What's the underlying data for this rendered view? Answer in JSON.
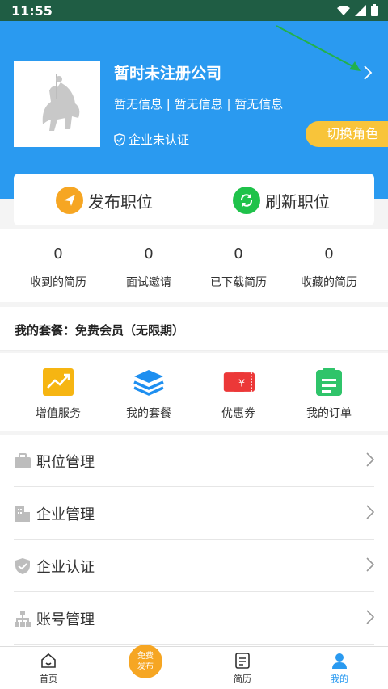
{
  "status_bar": {
    "time": "11:55"
  },
  "header": {
    "company_name": "暂时未注册公司",
    "info_1": "暂无信息",
    "info_2": "暂无信息",
    "info_3": "暂无信息",
    "separator": "|",
    "certification": "企业未认证",
    "switch_role": "切换角色",
    "bg_color": "#2a9af0"
  },
  "actions": {
    "publish": "发布职位",
    "refresh": "刷新职位"
  },
  "stats": [
    {
      "value": "0",
      "label": "收到的简历"
    },
    {
      "value": "0",
      "label": "面试邀请"
    },
    {
      "value": "0",
      "label": "已下载简历"
    },
    {
      "value": "0",
      "label": "收藏的简历"
    }
  ],
  "package": {
    "text": "我的套餐：免费会员（无限期）"
  },
  "services": [
    {
      "label": "增值服务",
      "icon": "trend-icon"
    },
    {
      "label": "我的套餐",
      "icon": "layers-icon"
    },
    {
      "label": "优惠券",
      "icon": "coupon-icon"
    },
    {
      "label": "我的订单",
      "icon": "order-icon"
    }
  ],
  "menu": [
    {
      "label": "职位管理",
      "icon": "briefcase-icon"
    },
    {
      "label": "企业管理",
      "icon": "building-icon"
    },
    {
      "label": "企业认证",
      "icon": "shield-check-icon"
    },
    {
      "label": "账号管理",
      "icon": "org-chart-icon"
    }
  ],
  "tabbar": {
    "home": "首页",
    "fab_line1": "免费",
    "fab_line2": "发布",
    "resume": "简历",
    "mine": "我的",
    "active_color": "#2a9af0"
  }
}
